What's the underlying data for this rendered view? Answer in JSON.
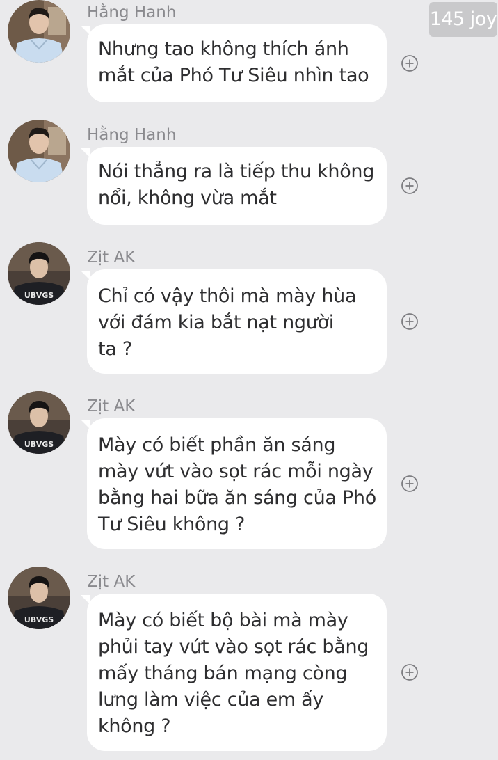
{
  "watermark": "145 joy",
  "messages": [
    {
      "sender": "Hằng Hanh",
      "avatar": "hang-hanh",
      "lines": [
        "Nhưng tao không thích ánh",
        "mắt của Phó Tư Siêu nhìn tao"
      ]
    },
    {
      "sender": "Hằng Hanh",
      "avatar": "hang-hanh",
      "lines": [
        "Nói thẳng ra là tiếp thu không",
        "nổi, không vừa mắt"
      ]
    },
    {
      "sender": "Zịt AK",
      "avatar": "zit-ak",
      "lines": [
        "Chỉ có vậy thôi mà mày hùa",
        "với đám kia bắt nạt người",
        "ta ?"
      ]
    },
    {
      "sender": "Zịt AK",
      "avatar": "zit-ak",
      "lines": [
        "Mày có biết phần ăn sáng",
        "mày vứt vào sọt rác mỗi ngày",
        "bằng hai bữa ăn sáng của Phó",
        "Tư Siêu không ?"
      ]
    },
    {
      "sender": "Zịt AK",
      "avatar": "zit-ak",
      "lines": [
        "Mày có biết bộ bài mà mày",
        "phủi tay vứt vào sọt rác bằng",
        "mấy tháng bán mạng còng",
        "lưng làm việc của em ấy",
        "không ?"
      ]
    }
  ],
  "avatar_text": "UBVGS",
  "icons": {
    "react": "plus-circle-icon"
  },
  "colors": {
    "background": "#eaeaec",
    "bubble": "#ffffff",
    "text": "#2e2e30",
    "sender": "#8a8a8e"
  }
}
